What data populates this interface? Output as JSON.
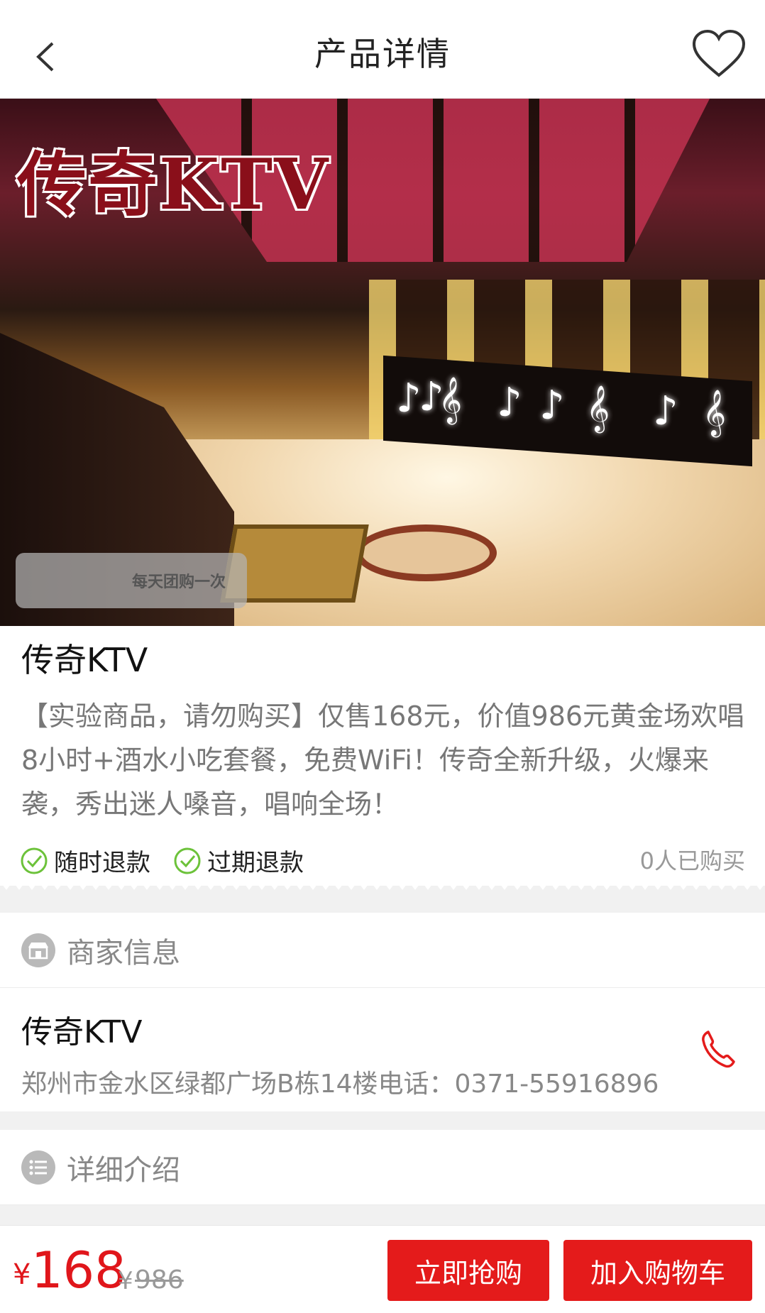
{
  "header": {
    "title": "产品详情"
  },
  "hero": {
    "brand": "传奇KTV",
    "stamp": "每天团购一次",
    "notes": [
      "♪",
      "♪",
      "𝄞",
      "♪",
      "♪",
      "𝄞",
      "♪",
      "𝄞"
    ]
  },
  "product": {
    "name": "传奇KTV",
    "description": "【实验商品，请勿购买】仅售168元，价值986元黄金场欢唱8小时+酒水小吃套餐，免费WiFi！传奇全新升级，火爆来袭，秀出迷人嗓音，唱响全场！",
    "tags": [
      "随时退款",
      "过期退款"
    ],
    "sold": "0人已购买"
  },
  "merchant": {
    "section_title": "商家信息",
    "name": "传奇KTV",
    "address": "郑州市金水区绿都广场B栋14楼电话：0371-55916896"
  },
  "detail": {
    "section_title": "详细介绍"
  },
  "footer": {
    "currency": "¥",
    "price": "168",
    "old_currency": "¥",
    "old_price": "986",
    "buy_label": "立即抢购",
    "cart_label": "加入购物车"
  },
  "colors": {
    "accent": "#e41b1b",
    "check": "#6cc23a"
  },
  "icons": [
    "back-arrow-icon",
    "heart-icon",
    "check-circle-icon",
    "shop-icon",
    "phone-icon",
    "list-icon"
  ]
}
